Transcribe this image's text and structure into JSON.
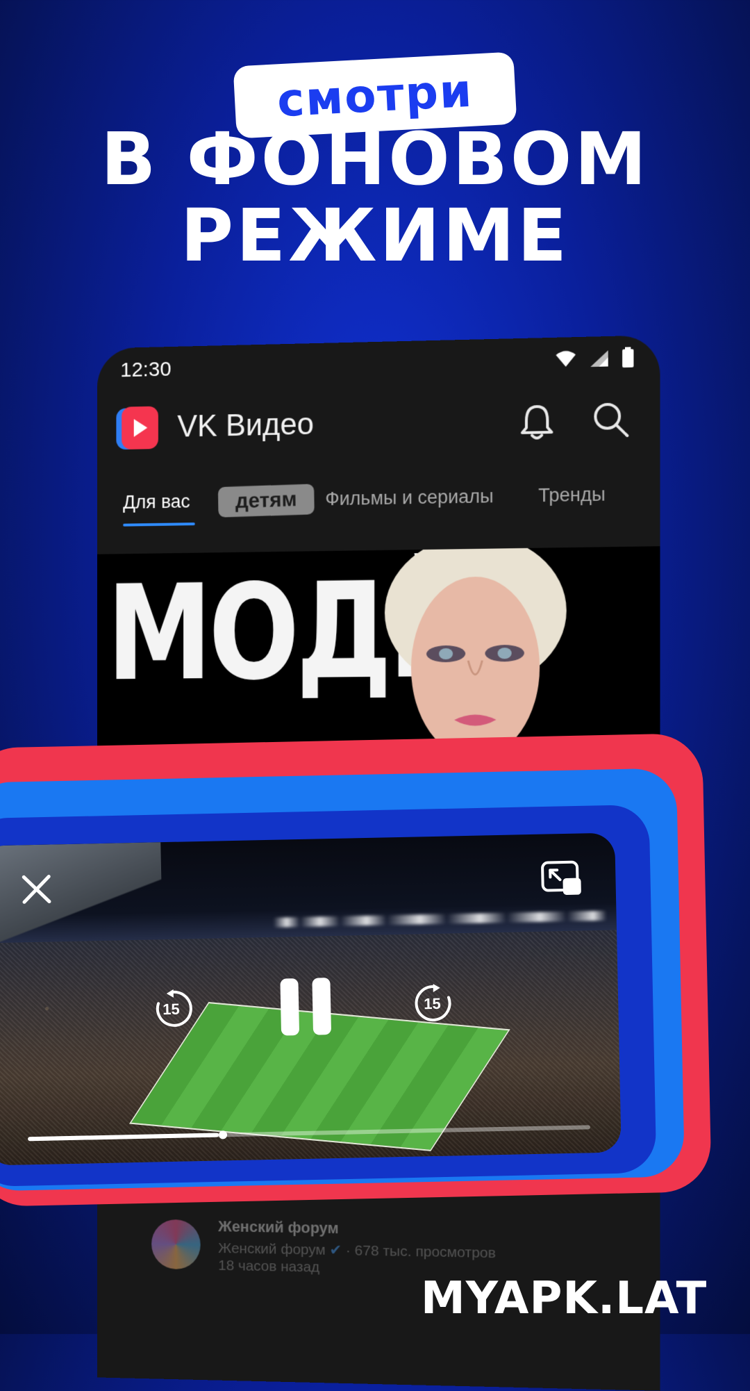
{
  "promo": {
    "badge": "смотри",
    "line1": "в фоновом",
    "line2": "режиме"
  },
  "status_bar": {
    "time": "12:30"
  },
  "app": {
    "title": "VK Видео",
    "tabs": [
      "Для вас",
      "детям",
      "Фильмы и сериалы",
      "Тренды"
    ],
    "active_tab": "Для вас"
  },
  "banner": {
    "text": "МОДЙ"
  },
  "player": {
    "rewind_seconds": "15",
    "forward_seconds": "15",
    "progress": 0.34,
    "state": "playing"
  },
  "list_item": {
    "title": "Женский форум",
    "channel": "Женский форум",
    "views": "· 678 тыс. просмотров",
    "time": "18 часов назад"
  },
  "icons": {
    "bell": "bell-icon",
    "search": "search-icon",
    "close": "close-icon",
    "expand": "expand-icon",
    "rewind": "rewind-15-icon",
    "pause": "pause-icon",
    "forward": "forward-15-icon"
  },
  "colors": {
    "accent_blue": "#1b3df0",
    "frame_red": "#f0364e",
    "frame_blue": "#1a78f2",
    "tab_underline": "#2f8cff"
  },
  "watermark": "MYAPK.LAT"
}
